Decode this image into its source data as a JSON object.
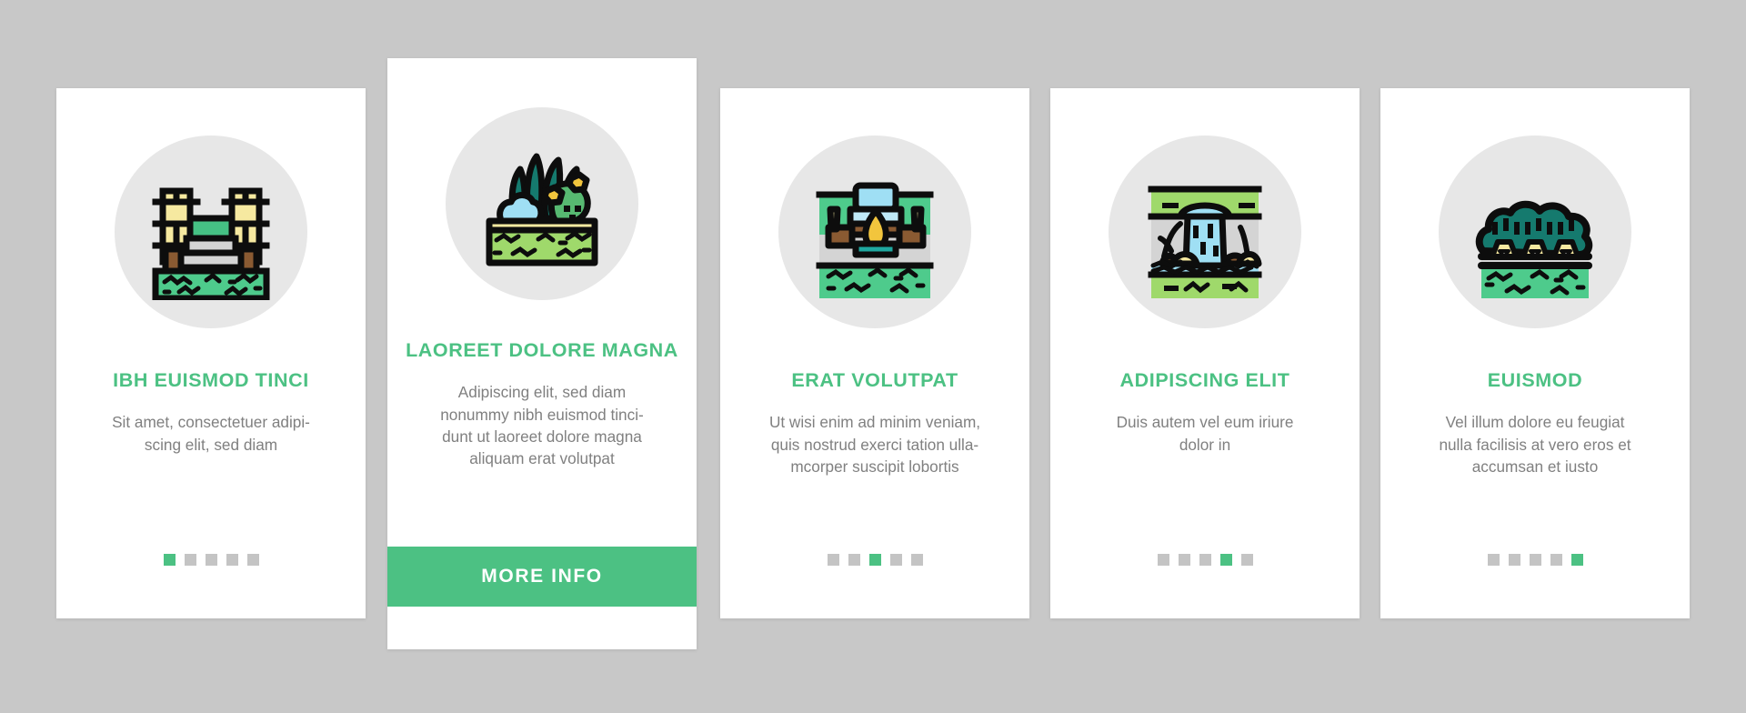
{
  "theme": {
    "page_background": "#c8c8c8",
    "card_background": "#ffffff",
    "accent_green": "#4cc183",
    "title_color": "#4cc183",
    "body_color": "#808080",
    "dot_inactive": "#c4c4c4",
    "illustration_circle": "#e7e7e7"
  },
  "cards": [
    {
      "id": "card-1",
      "featured": false,
      "icon_name": "park-amphitheater-bridge-icon",
      "title": "IBH EUISMOD TINCI",
      "body": "Sit amet, consectetuer adipi-\nscing elit, sed diam",
      "dots": {
        "count": 5,
        "active_index": 0
      },
      "cta": null
    },
    {
      "id": "card-2",
      "featured": true,
      "icon_name": "flower-garden-bed-icon",
      "title": "LAOREET DOLORE MAGNA",
      "body": "Adipiscing elit, sed diam\nnonummy nibh euismod tinci-\ndunt ut laoreet dolore magna\naliquam erat volutpat",
      "dots": null,
      "cta": "MORE INFO"
    },
    {
      "id": "card-3",
      "featured": false,
      "icon_name": "fire-pit-benches-icon",
      "title": "ERAT VOLUTPAT",
      "body": "Ut wisi enim ad minim veniam,\nquis nostrud exerci tation ulla-\nmcorper suscipit lobortis",
      "dots": {
        "count": 5,
        "active_index": 2
      },
      "cta": null
    },
    {
      "id": "card-4",
      "featured": false,
      "icon_name": "waterfall-pond-icon",
      "title": "ADIPISCING ELIT",
      "body": "Duis autem vel eum iriure\ndolor in",
      "dots": {
        "count": 5,
        "active_index": 3
      },
      "cta": null
    },
    {
      "id": "card-5",
      "featured": false,
      "icon_name": "hedge-trees-lighting-icon",
      "title": "EUISMOD",
      "body": "Vel illum dolore eu feugiat\nnulla facilisis at vero eros et\naccumsan et iusto",
      "dots": {
        "count": 5,
        "active_index": 4
      },
      "cta": null
    }
  ]
}
